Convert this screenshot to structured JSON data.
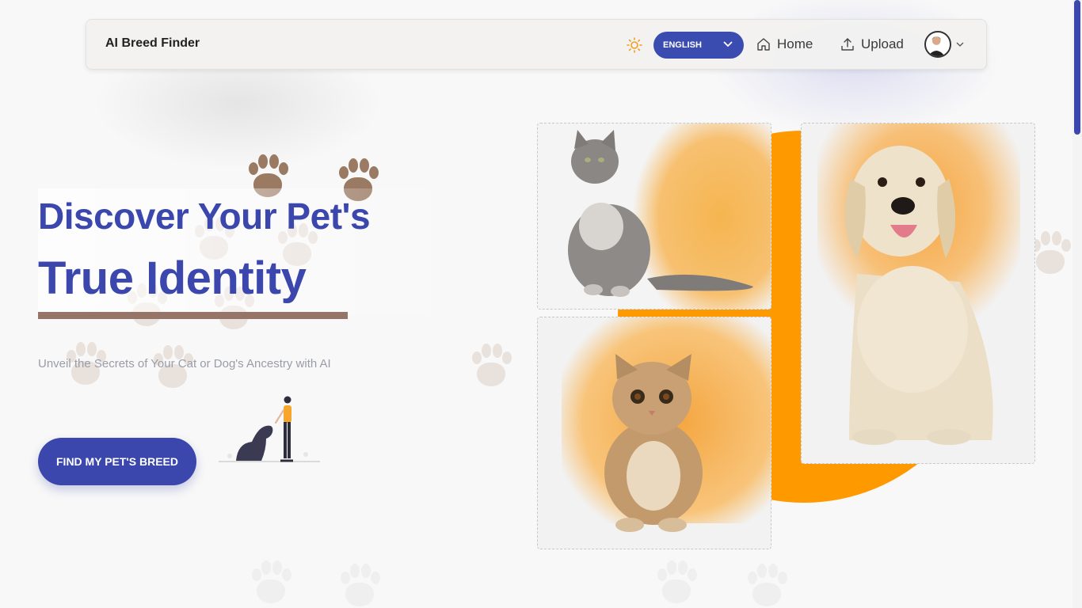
{
  "navbar": {
    "brand": "AI Breed Finder",
    "language": "ENGLISH",
    "home": "Home",
    "upload": "Upload",
    "theme_icon": "sun-icon",
    "avatar_icon": "user-avatar"
  },
  "hero": {
    "title_line1": "Discover Your Pet's",
    "title_line2": "True Identity",
    "subtitle": "Unveil the Secrets of Your Cat or Dog's Ancestry with AI",
    "cta": "FIND MY PET'S BREED"
  },
  "colors": {
    "primary": "#3b47ad",
    "accent": "#ff9900",
    "underline": "#977468"
  },
  "images": [
    "grey-cat",
    "tabby-kitten",
    "golden-retriever"
  ]
}
